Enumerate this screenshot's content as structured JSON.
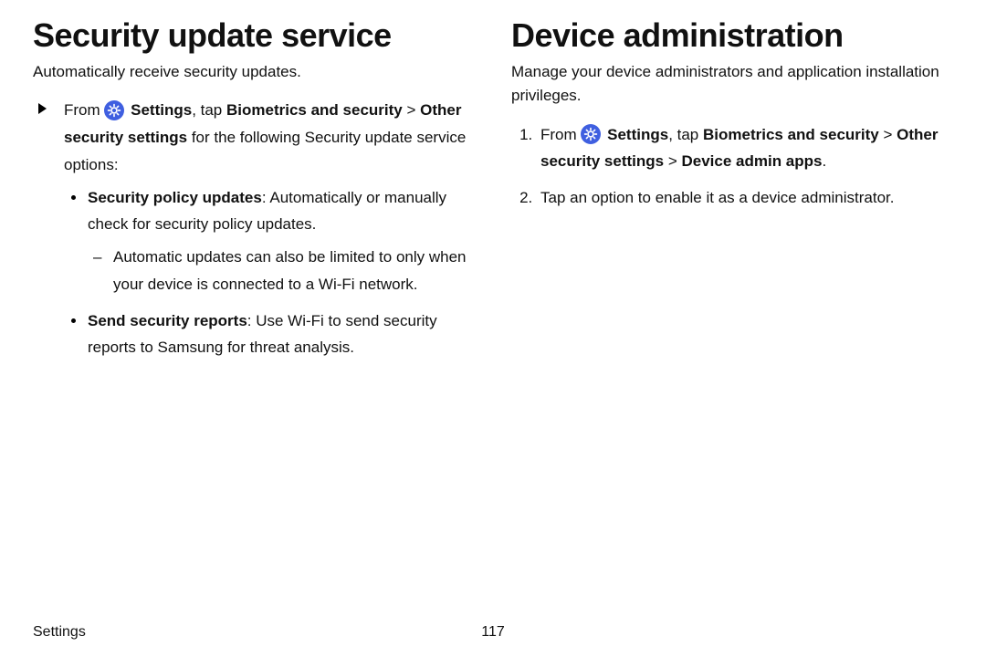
{
  "left": {
    "heading": "Security update service",
    "intro": "Automatically receive security updates.",
    "from_prefix": "From ",
    "settings_word": "Settings",
    "tap_word": ", tap ",
    "path1": "Biometrics and security",
    "chevron": " > ",
    "path2": "Other security settings",
    "from_suffix": " for the following Security update service options:",
    "bullet1_bold": "Security policy updates",
    "bullet1_rest": ": Automatically or manually check for security policy updates.",
    "bullet1_sub": "Automatic updates can also be limited to only when your device is connected to a Wi-Fi network.",
    "bullet2_bold": "Send security reports",
    "bullet2_rest": ": Use Wi-Fi to send security reports to Samsung for threat analysis."
  },
  "right": {
    "heading": "Device administration",
    "intro": "Manage your device administrators and application installation privileges.",
    "step1_prefix": "From ",
    "settings_word": "Settings",
    "tap_word": ", tap ",
    "path1": "Biometrics and security",
    "chevron": " > ",
    "path2": "Other security settings",
    "chevron2": " > ",
    "path3": "Device admin apps",
    "period": ".",
    "step2": "Tap an option to enable it as a device administrator."
  },
  "footer": {
    "section": "Settings",
    "page": "117"
  }
}
